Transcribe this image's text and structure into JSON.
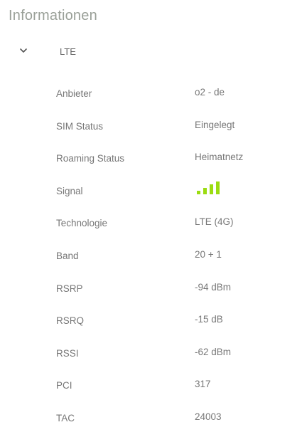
{
  "page": {
    "title": "Informationen"
  },
  "section": {
    "title": "LTE",
    "expand_icon": "chevron-down-icon"
  },
  "rows": [
    {
      "label": "Anbieter",
      "value": "o2 - de"
    },
    {
      "label": "SIM Status",
      "value": "Eingelegt"
    },
    {
      "label": "Roaming Status",
      "value": "Heimatnetz"
    },
    {
      "label": "Signal",
      "value": null
    },
    {
      "label": "Technologie",
      "value": "LTE (4G)"
    },
    {
      "label": "Band",
      "value": "20 + 1"
    },
    {
      "label": "RSRP",
      "value": "-94 dBm"
    },
    {
      "label": "RSRQ",
      "value": "-15 dB"
    },
    {
      "label": "RSSI",
      "value": "-62 dBm"
    },
    {
      "label": "PCI",
      "value": "317"
    },
    {
      "label": "TAC",
      "value": "24003"
    }
  ],
  "signal": {
    "icon": "signal-strength-icon",
    "bars_total": 4,
    "bars_filled": 4,
    "color": "#9bdc11"
  }
}
